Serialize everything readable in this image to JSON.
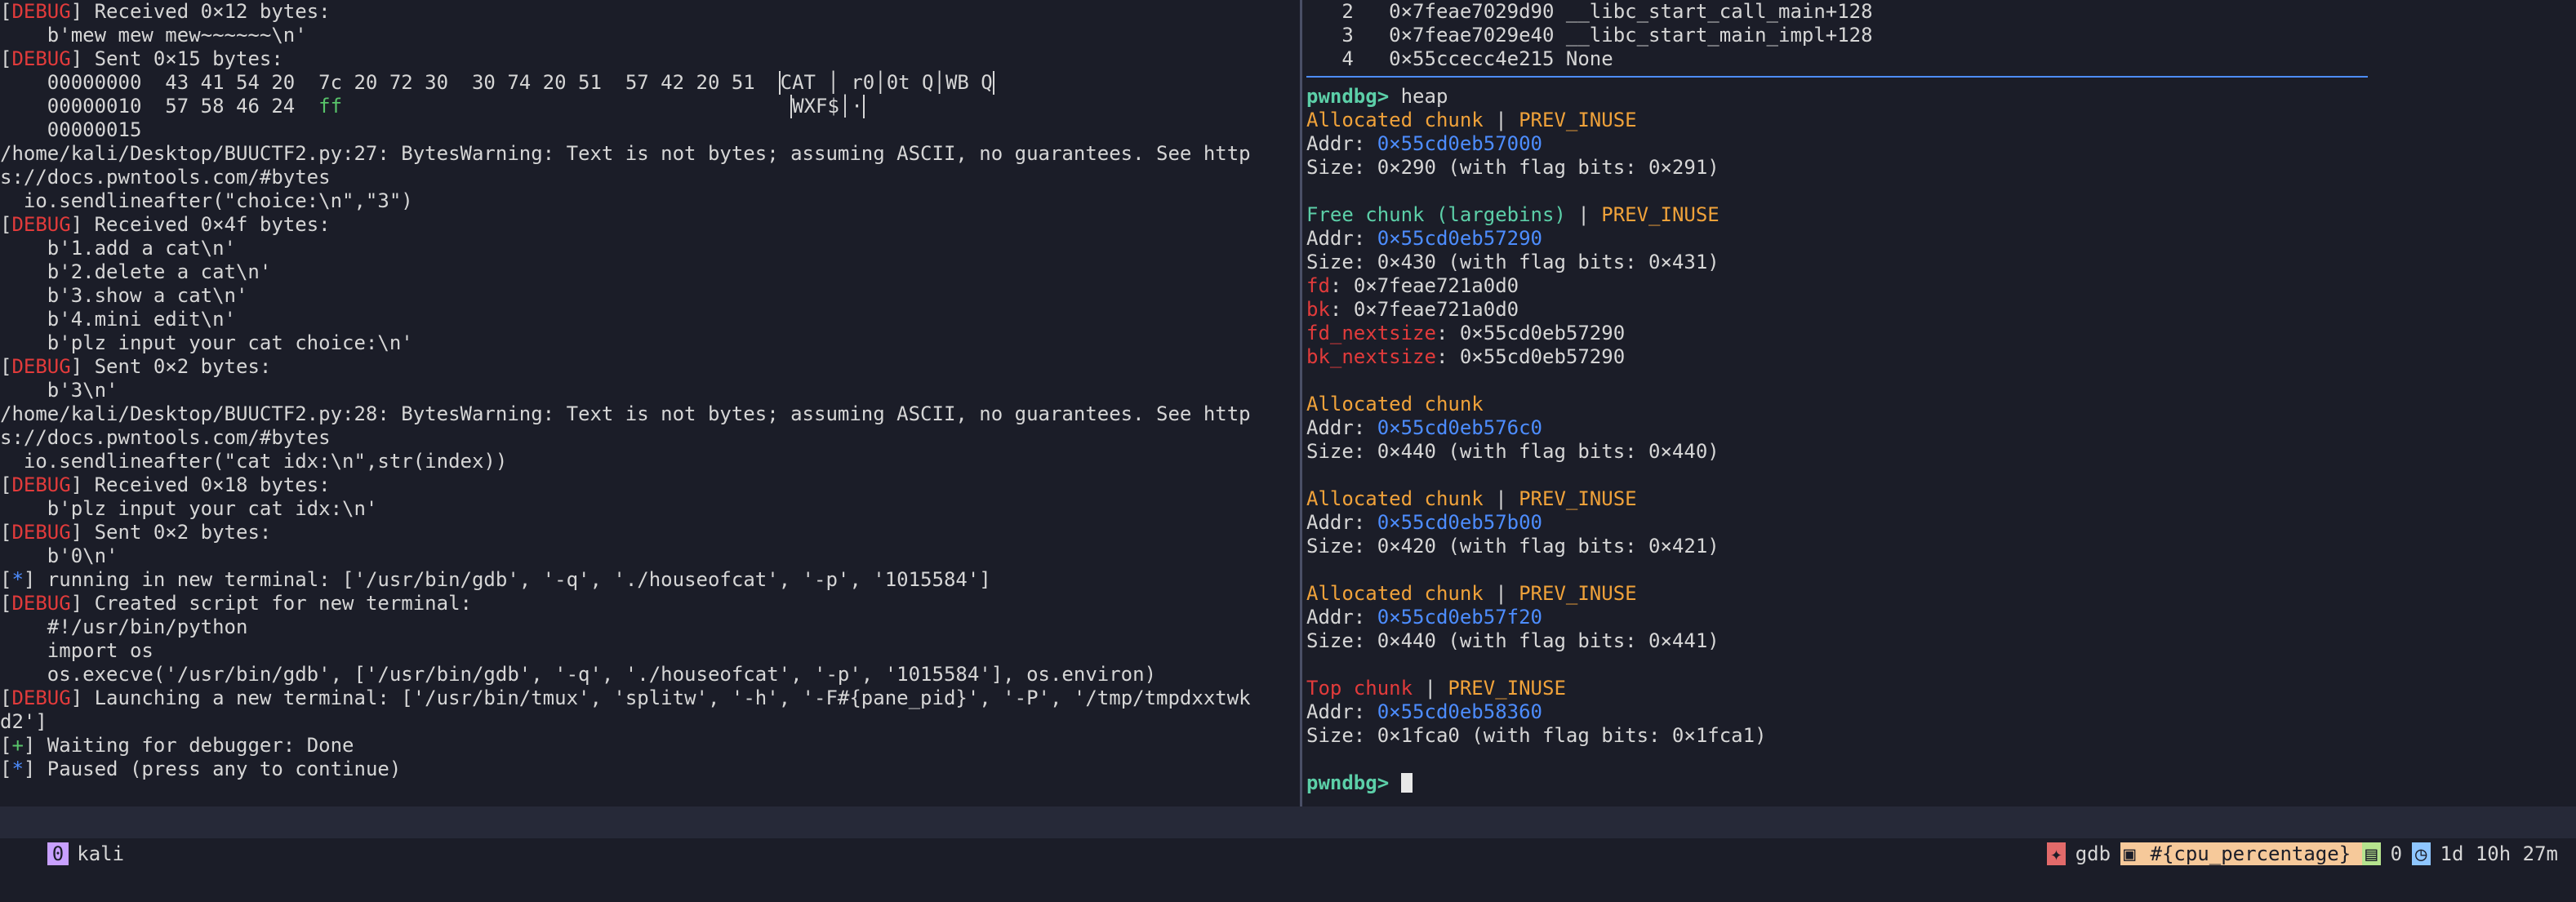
{
  "left": {
    "l1": {
      "tag": "DEBUG",
      "text": " Received 0×12 bytes:"
    },
    "l2": "    b'mew mew mew~~~~~~\\n'",
    "l3": {
      "tag": "DEBUG",
      "text": " Sent 0×15 bytes:"
    },
    "l4": {
      "off": "    00000000  ",
      "hex": "43 41 54 20  7c 20 72 30  30 74 20 51  57 42 20 51  ",
      "ascii": "CAT │ r0│0t Q│WB Q"
    },
    "l5": {
      "off": "    00000010  ",
      "hex": "57 58 46 24  ",
      "hexg": "ff",
      "pad": "                                      ",
      "ascii": "WXF$│·"
    },
    "l6": "    00000015",
    "l7": "/home/kali/Desktop/BUUCTF2.py:27: BytesWarning: Text is not bytes; assuming ASCII, no guarantees. See http",
    "l8": "s://docs.pwntools.com/#bytes",
    "l9": "  io.sendlineafter(\"choice:\\n\",\"3\")",
    "l10": {
      "tag": "DEBUG",
      "text": " Received 0×4f bytes:"
    },
    "l11": "    b'1.add a cat\\n'",
    "l12": "    b'2.delete a cat\\n'",
    "l13": "    b'3.show a cat\\n'",
    "l14": "    b'4.mini edit\\n'",
    "l15": "    b'plz input your cat choice:\\n'",
    "l16": {
      "tag": "DEBUG",
      "text": " Sent 0×2 bytes:"
    },
    "l17": "    b'3\\n'",
    "l18": "/home/kali/Desktop/BUUCTF2.py:28: BytesWarning: Text is not bytes; assuming ASCII, no guarantees. See http",
    "l19": "s://docs.pwntools.com/#bytes",
    "l20": "  io.sendlineafter(\"cat idx:\\n\",str(index))",
    "l21": {
      "tag": "DEBUG",
      "text": " Received 0×18 bytes:"
    },
    "l22": "    b'plz input your cat idx:\\n'",
    "l23": {
      "tag": "DEBUG",
      "text": " Sent 0×2 bytes:"
    },
    "l24": "    b'0\\n'",
    "l25": {
      "tag": "*",
      "text": " running in new terminal: ['/usr/bin/gdb', '-q', './houseofcat', '-p', '1015584']"
    },
    "l26": {
      "tag": "DEBUG",
      "text": " Created script for new terminal:"
    },
    "l27": "    #!/usr/bin/python",
    "l28": "    import os",
    "l29": "    os.execve('/usr/bin/gdb', ['/usr/bin/gdb', '-q', './houseofcat', '-p', '1015584'], os.environ)",
    "l30": {
      "tag": "DEBUG",
      "text": " Launching a new terminal: ['/usr/bin/tmux', 'splitw', '-h', '-F#{pane_pid}', '-P', '/tmp/tmpdxxtwk"
    },
    "l31": "d2']",
    "l32": {
      "tag": "+",
      "text": " Waiting for debugger: Done"
    },
    "l33": {
      "tag": "*",
      "text": " Paused (press any to continue)"
    }
  },
  "right": {
    "bt": [
      {
        "idx": "   2   ",
        "addr": "0×7feae7029d90",
        "sym": " __libc_start_call_main+128"
      },
      {
        "idx": "   3   ",
        "addr": "0×7feae7029e40",
        "sym": " __libc_start_main_impl+128"
      },
      {
        "idx": "   4   ",
        "addr": "0×55ccecc4e215",
        "sym": " None"
      }
    ],
    "prompt": "pwndbg>",
    "cmd": " heap",
    "chunks": [
      {
        "kind": "Allocated chunk",
        "cls": "alloc",
        "flag": "PREV_INUSE",
        "addr": "0×55cd0eb57000",
        "size": "0×290 (with flag bits: 0×291)"
      },
      {
        "kind": "Free chunk (largebins)",
        "cls": "free",
        "flag": "PREV_INUSE",
        "addr": "0×55cd0eb57290",
        "size": "0×430 (with flag bits: 0×431)",
        "fd": "0×7feae721a0d0",
        "bk": "0×7feae721a0d0",
        "fd_nextsize": "0×55cd0eb57290",
        "bk_nextsize": "0×55cd0eb57290"
      },
      {
        "kind": "Allocated chunk",
        "cls": "alloc",
        "flag": "",
        "addr": "0×55cd0eb576c0",
        "size": "0×440 (with flag bits: 0×440)"
      },
      {
        "kind": "Allocated chunk",
        "cls": "alloc",
        "flag": "PREV_INUSE",
        "addr": "0×55cd0eb57b00",
        "size": "0×420 (with flag bits: 0×421)"
      },
      {
        "kind": "Allocated chunk",
        "cls": "alloc",
        "flag": "PREV_INUSE",
        "addr": "0×55cd0eb57f20",
        "size": "0×440 (with flag bits: 0×441)"
      },
      {
        "kind": "Top chunk",
        "cls": "top",
        "flag": "PREV_INUSE",
        "addr": "0×55cd0eb58360",
        "size": "0×1fca0 (with flag bits: 0×1fca1)"
      }
    ],
    "labels": {
      "addr": "Addr: ",
      "size": "Size: ",
      "fd": "fd",
      "bk": "bk",
      "fd_nextsize": "fd_nextsize",
      "bk_nextsize": "bk_nextsize",
      "sep": " | "
    }
  },
  "status": {
    "session_idx": "0",
    "session_name": "kali",
    "gdb_label": "gdb",
    "cpu": "#{cpu_percentage}",
    "num": "0",
    "uptime": "1d 10h 27m"
  }
}
